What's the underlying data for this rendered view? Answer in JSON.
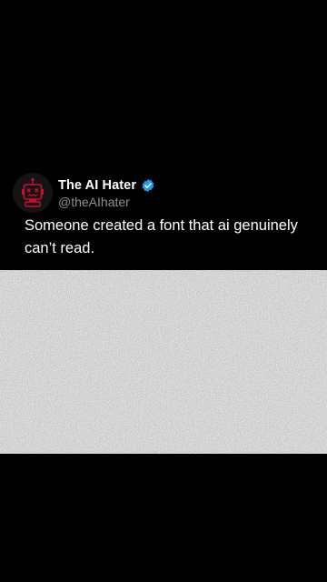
{
  "post": {
    "author": {
      "display_name": "The AI Hater",
      "handle": "@theAIhater",
      "verified": true,
      "avatar_icon": "robot-face-icon",
      "verified_icon": "verified-badge-icon"
    },
    "text_lines": [
      "Someone created a font that ai genuinely",
      "can’t read."
    ],
    "media": {
      "kind": "image",
      "description_icon": "noise-pattern"
    }
  },
  "colors": {
    "background": "#000000",
    "text": "#ffffff",
    "handle": "#8b8f94",
    "verified": "#1d9bf0",
    "avatar_accent": "#c8102e"
  }
}
